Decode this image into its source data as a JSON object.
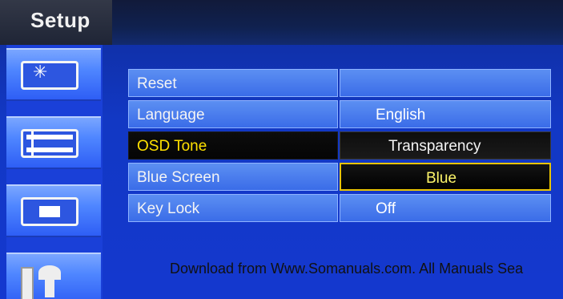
{
  "header": {
    "title": "Setup"
  },
  "sidebar": {
    "items": [
      {
        "icon": "picture-settings-icon"
      },
      {
        "icon": "film-strip-icon"
      },
      {
        "icon": "screen-icon"
      },
      {
        "icon": "tools-icon"
      }
    ]
  },
  "menu": {
    "rows": [
      {
        "label": "Reset",
        "value": ""
      },
      {
        "label": "Language",
        "value": "English"
      },
      {
        "label": "OSD Tone",
        "value": "Transparency"
      },
      {
        "label": "Blue Screen",
        "value": "Blue"
      },
      {
        "label": "Key Lock",
        "value": "Off"
      }
    ],
    "selected_row": "OSD Tone",
    "active_value_row": "Blue Screen"
  },
  "footer": {
    "watermark": "Download from Www.Somanuals.com. All Manuals Sea"
  },
  "colors": {
    "highlight_text": "#ffe100",
    "panel_blue": "#3a6ce8",
    "background_blue": "#1438cf"
  }
}
